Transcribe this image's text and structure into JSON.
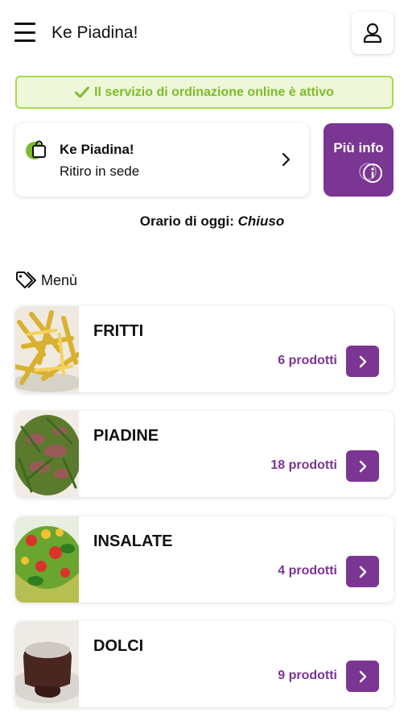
{
  "header": {
    "menu_icon": "hamburger-menu-icon",
    "title": "Ke Piadina!",
    "user_icon": "user-profile-icon"
  },
  "status": {
    "icon": "check-icon",
    "text": "Il servizio di ordinazione online è attivo",
    "color": "#7cbb2d"
  },
  "store": {
    "icon": "shopping-bag-icon",
    "name": "Ke Piadina!",
    "mode": "Ritiro in sede",
    "chevron": "chevron-right-icon"
  },
  "info_button": {
    "label": "Più info",
    "icon": "info-circle-icon",
    "color": "#7b3593"
  },
  "hours": {
    "label": "Orario di oggi:",
    "value": "Chiuso"
  },
  "menu": {
    "icon": "tag-icon",
    "heading": "Menù",
    "categories": [
      {
        "title": "FRITTI",
        "count": "6 prodotti",
        "image": "fries-photo"
      },
      {
        "title": "PIADINE",
        "count": "18 prodotti",
        "image": "piadina-filling-photo"
      },
      {
        "title": "INSALATE",
        "count": "4 prodotti",
        "image": "salad-photo"
      },
      {
        "title": "DOLCI",
        "count": "9 prodotti",
        "image": "chocolate-cake-photo"
      }
    ]
  },
  "colors": {
    "accent": "#7b3593",
    "success": "#7cbb2d",
    "success_bg": "#eef8d8"
  }
}
